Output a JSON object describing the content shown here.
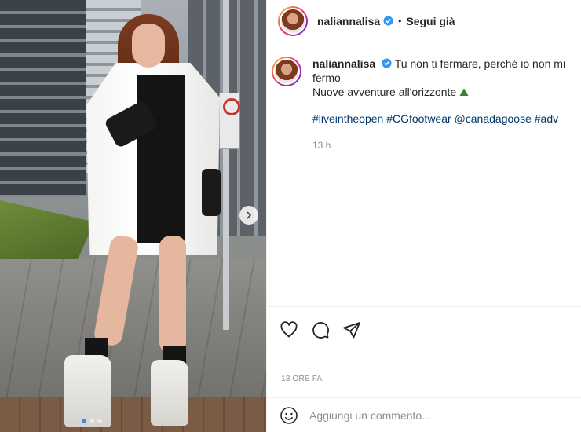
{
  "post": {
    "username": "naliannalisa",
    "separator": "•",
    "follow_label": "Segui già"
  },
  "caption": {
    "username": "naliannalisa",
    "text_line1": "Tu non ti fermare, perché io non mi fermo",
    "text_line2": "Nuove avventure all'orizzonte",
    "mountain_emoji": "⛰",
    "hashtags": [
      "#liveintheopen",
      "#CGfootwear",
      "@canadagoose",
      "#adv"
    ],
    "time": "13 h"
  },
  "actions": {
    "like_icon": "heart-icon",
    "comment_icon": "comment-icon",
    "share_icon": "paper-plane-icon"
  },
  "timestamp": "13 ORE FA",
  "comment_box": {
    "emoji_icon": "smiley-icon",
    "placeholder": "Aggiungi un commento..."
  },
  "carousel": {
    "total": 3,
    "active_index": 0
  },
  "colors": {
    "verified": "#3897f0",
    "link": "#00376b",
    "secondary_text": "#8e8e8e",
    "active_dot": "#3a8fe0"
  }
}
